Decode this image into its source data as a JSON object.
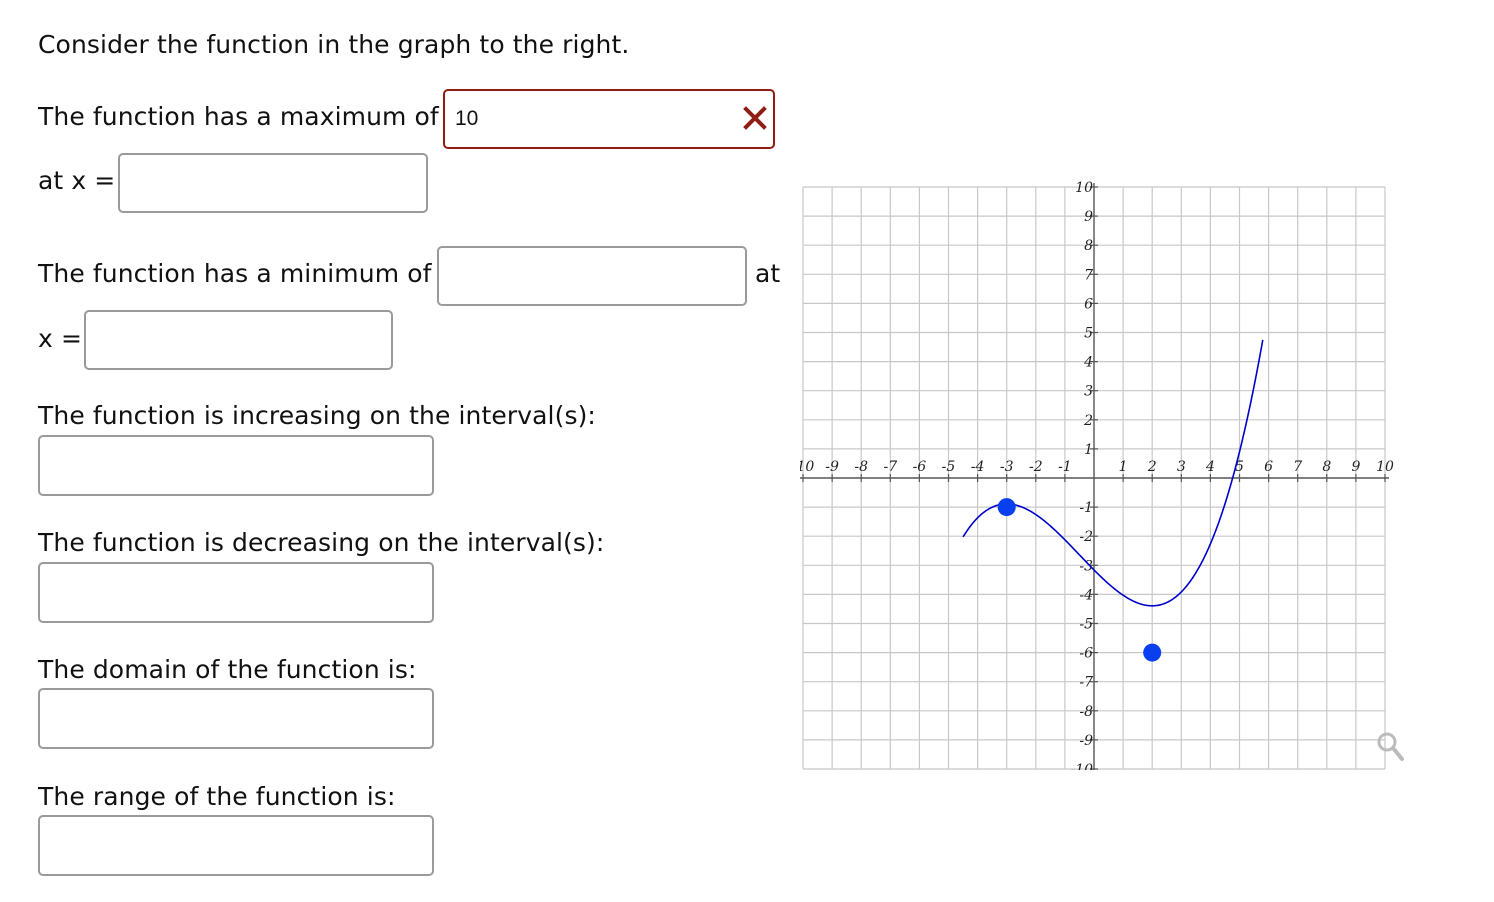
{
  "title": "Consider the function in the graph to the right.",
  "max": {
    "prefix": "The function has a maximum of",
    "value": "10",
    "status": "incorrect",
    "status_color": "#8f1d14",
    "at_label": "at x ="
  },
  "min": {
    "prefix": "The function has a minimum of",
    "value": "",
    "suffix": "at",
    "x_label": "x ="
  },
  "increasing_label": "The function is increasing on the interval(s):",
  "decreasing_label": "The function is decreasing on the interval(s):",
  "domain_label": "The domain of the function is:",
  "range_label": "The range of the function is:",
  "answers": {
    "max_x": "",
    "min_x": "",
    "increasing": "",
    "decreasing": "",
    "domain": "",
    "range": ""
  },
  "zoom_icon": "magnifier-icon",
  "chart_data": {
    "type": "line",
    "xlim": [
      -10,
      10
    ],
    "ylim": [
      -10,
      10
    ],
    "x_ticks": [
      -10,
      -9,
      -8,
      -7,
      -6,
      -5,
      -4,
      -3,
      -2,
      -1,
      1,
      2,
      3,
      4,
      5,
      6,
      7,
      8,
      9,
      10
    ],
    "y_ticks": [
      -10,
      -9,
      -8,
      -7,
      -6,
      -5,
      -4,
      -3,
      -2,
      -1,
      1,
      2,
      3,
      4,
      5,
      6,
      7,
      8,
      9,
      10
    ],
    "grid": true,
    "curve_color": "#0000cc",
    "point_color": "#0a3ff0",
    "points": [
      {
        "x": -3,
        "y": -1
      },
      {
        "x": 2,
        "y": -6
      }
    ]
  }
}
